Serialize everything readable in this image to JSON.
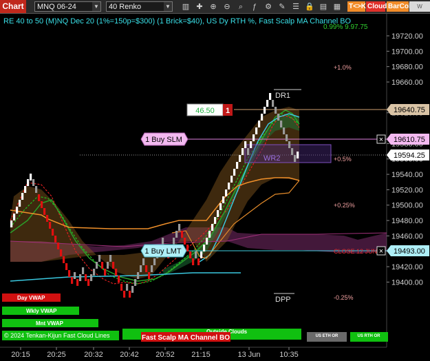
{
  "toolbar": {
    "app_label": "Chart",
    "instrument": "MNQ 06-24",
    "bar_type": "40 Renko",
    "icons": [
      "bars-icon",
      "crosshair-icon",
      "zoom-in-icon",
      "zoom-out-icon",
      "magnify-icon",
      "indicators-icon",
      "strategy-icon",
      "drawing-icon",
      "properties-icon",
      "lock-icon",
      "data-box-icon",
      "grid-icon"
    ],
    "btn_tk": "T<>K",
    "btn_cloud": "Cloud",
    "btn_barcol": "BarCol",
    "btn_w": "W VWAP",
    "colors": {
      "tk": "#f28c28",
      "cloud": "#e0302a",
      "barcol": "#f28c28",
      "w": "#d9d9d9"
    }
  },
  "chart": {
    "header_text": "RE 40 to 50 (M)NQ Dec 20 (1%=150p=$300) (1 Brick=$40), US Dy RTH %, Fast Scalp MA Channel BO",
    "header_right": "0.99% 9.97.75",
    "price_axis": {
      "levels": [
        "19720.00",
        "19700.00",
        "19680.00",
        "19660.00",
        "19620.00",
        "19580.00",
        "19560.00",
        "19540.00",
        "19520.00",
        "19500.00",
        "19480.00",
        "19460.00",
        "19440.00",
        "19420.00",
        "19400.00"
      ],
      "labels": [
        {
          "text": "19640.75",
          "bg": "#d9c3a5",
          "fg": "#000"
        },
        {
          "text": "19610.75",
          "bg": "#f3b9f0",
          "fg": "#000"
        },
        {
          "text": "19594.25",
          "bg": "#ffffff",
          "fg": "#000"
        },
        {
          "text": "19493.00",
          "bg": "#aeeff7",
          "fg": "#000"
        }
      ]
    },
    "time_axis": [
      "20:15",
      "20:25",
      "20:32",
      "20:42",
      "20:52",
      "21:15",
      "13 Jun",
      "10:35"
    ],
    "pct_labels": [
      {
        "text": "+1.0%",
        "color": "#f0a0a0"
      },
      {
        "text": "+0.5%",
        "color": "#f0a0a0"
      },
      {
        "text": "+0.25%",
        "color": "#f0a0a0"
      },
      {
        "text": "-0.25%",
        "color": "#f0a0a0"
      },
      {
        "text": "CLOSE 12 JUN",
        "color": "#e03030"
      }
    ],
    "levels_text": {
      "dr1": "DR1",
      "wr2": "WR2",
      "dpp": "DPP"
    },
    "orders": {
      "target_qty_label": "46.50",
      "target_qty": "1",
      "buy_slm": "1 Buy SLM",
      "buy_lmt": "1 Buy LMT",
      "close_x": "×"
    },
    "bottom_badges": [
      {
        "text": "Day VWAP",
        "bg": "#d01010",
        "fg": "#fff"
      },
      {
        "text": "Wkly VWAP",
        "bg": "#10c010",
        "fg": "#fff"
      },
      {
        "text": "Mnt VWAP",
        "bg": "#10c010",
        "fg": "#fff"
      },
      {
        "text": "Outside Clouds",
        "bg": "#10c010",
        "fg": "#fff"
      },
      {
        "text": "US ETH OR",
        "bg": "#6a6a6a",
        "fg": "#fff"
      },
      {
        "text": "US RTH OR",
        "bg": "#10c010",
        "fg": "#fff"
      }
    ],
    "footer_left": "© 2024 Tenkan-Kijun Fast Cloud Lines",
    "strategy_badge": "Fast Scalp MA Channel BO"
  }
}
